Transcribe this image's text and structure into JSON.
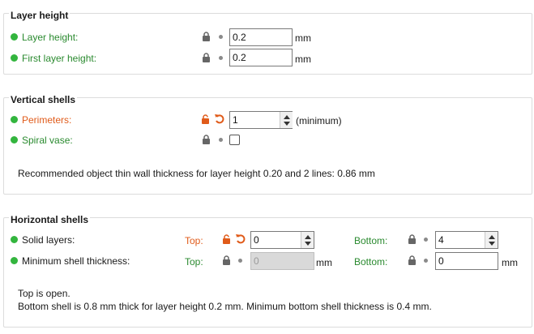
{
  "layer_height": {
    "title": "Layer height",
    "layer_height_label": "Layer height:",
    "layer_height_value": "0.2",
    "first_layer_label": "First layer height:",
    "first_layer_value": "0.2",
    "unit": "mm"
  },
  "vertical_shells": {
    "title": "Vertical shells",
    "perimeters_label": "Perimeters:",
    "perimeters_value": "1",
    "perimeters_suffix": "(minimum)",
    "spiral_label": "Spiral vase:",
    "spiral_checked": false,
    "note": "Recommended object thin wall thickness for layer height 0.20 and 2 lines: 0.86 mm"
  },
  "horizontal_shells": {
    "title": "Horizontal shells",
    "solid_label": "Solid layers:",
    "top_label": "Top:",
    "bottom_label": "Bottom:",
    "solid_top_value": "0",
    "solid_bottom_value": "4",
    "min_thickness_label": "Minimum shell thickness:",
    "min_top_value": "0",
    "min_bottom_value": "0",
    "unit": "mm",
    "note_line1": "Top is open.",
    "note_line2": "Bottom shell is 0.8 mm thick for layer height 0.2 mm. Minimum bottom shell thickness is 0.4 mm."
  },
  "colors": {
    "green": "#2a8a2f",
    "orange": "#e05b1a",
    "dot": "#33b53e"
  }
}
